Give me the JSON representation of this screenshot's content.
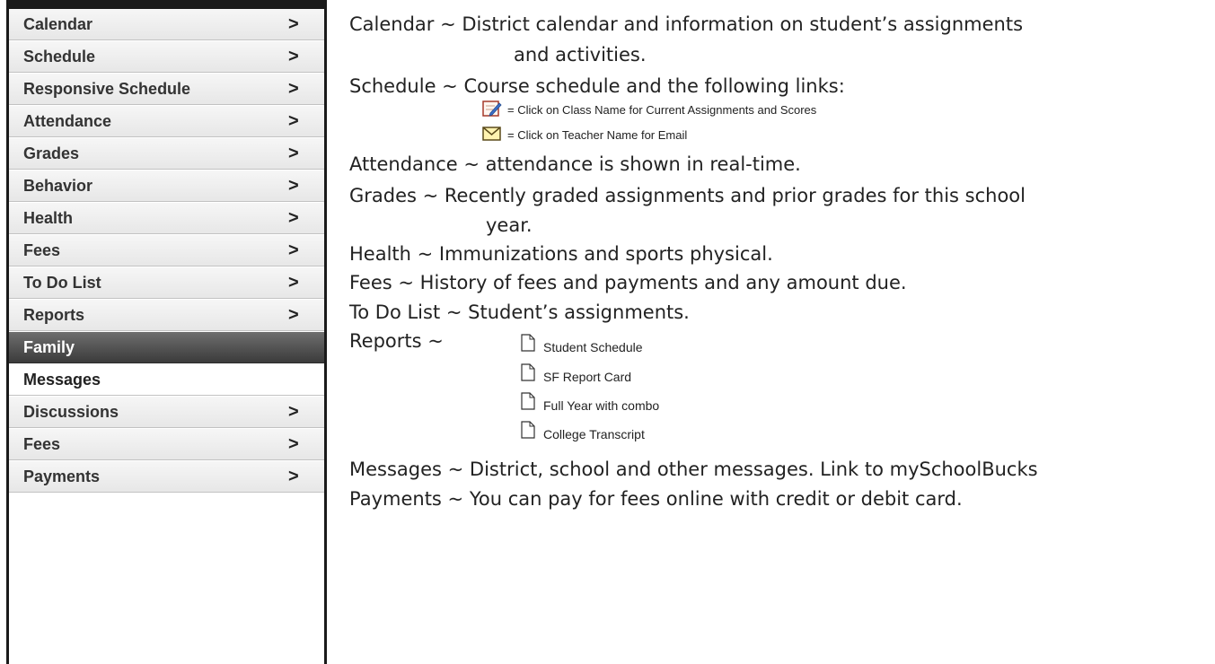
{
  "menu": {
    "chevron": ">",
    "items": [
      {
        "label": "Calendar",
        "arrow": true
      },
      {
        "label": "Schedule",
        "arrow": true
      },
      {
        "label": "Responsive Schedule",
        "arrow": true
      },
      {
        "label": "Attendance",
        "arrow": true
      },
      {
        "label": "Grades",
        "arrow": true
      },
      {
        "label": "Behavior",
        "arrow": true
      },
      {
        "label": "Health",
        "arrow": true
      },
      {
        "label": "Fees",
        "arrow": true
      },
      {
        "label": "To Do List",
        "arrow": true
      },
      {
        "label": "Reports",
        "arrow": true
      },
      {
        "label": "Family",
        "arrow": false
      },
      {
        "label": "Messages",
        "arrow": false
      },
      {
        "label": "Discussions",
        "arrow": true
      },
      {
        "label": "Fees",
        "arrow": true
      },
      {
        "label": "Payments",
        "arrow": true
      }
    ]
  },
  "descriptions": {
    "calendar_1": "Calendar ~ District calendar and information on student’s assignments",
    "calendar_2": "and activities.",
    "schedule": "Schedule ~ Course schedule and the following links:",
    "legend_assignments": "= Click on Class Name for Current Assignments and Scores",
    "legend_email": "= Click on Teacher Name for Email",
    "attendance": "Attendance ~ attendance is shown in real-time.",
    "grades_1": "Grades ~ Recently graded assignments and prior grades for this school",
    "grades_2": "year.",
    "health": "Health ~ Immunizations and sports physical.",
    "fees": "Fees ~ History of fees and payments and any amount due.",
    "todo": "To Do List ~ Student’s assignments.",
    "reports": "Reports ~",
    "report_items": [
      "Student Schedule",
      "SF Report Card",
      "Full Year with combo",
      "College Transcript"
    ],
    "messages": "Messages ~ District, school and other messages. Link to mySchoolBucks",
    "payments": "Payments ~ You can pay for fees online with credit or debit card."
  },
  "icons": {
    "assignments": "assignment-pencil-icon",
    "email": "email-envelope-icon",
    "document": "document-icon"
  }
}
